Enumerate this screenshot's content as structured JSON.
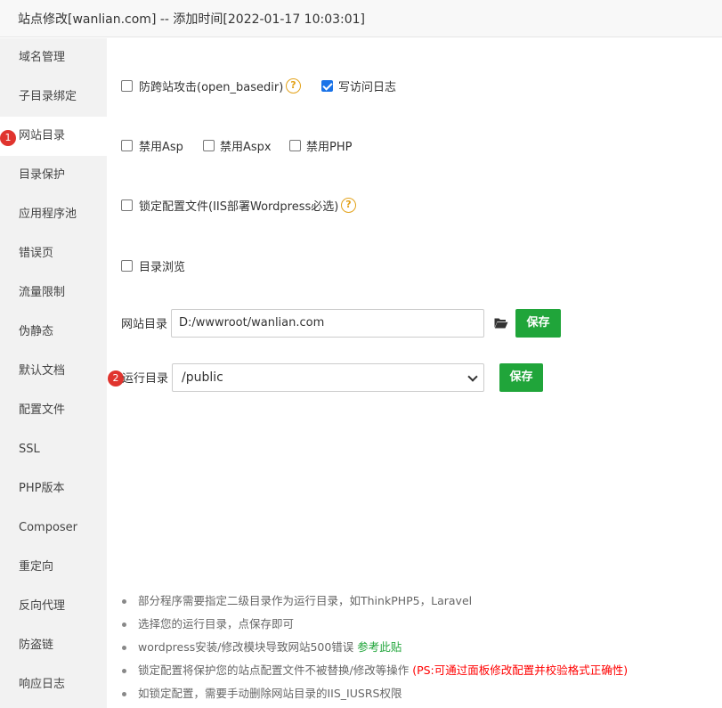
{
  "window": {
    "title": "站点修改[wanlian.com] -- 添加时间[2022-01-17 10:03:01]"
  },
  "sidebar": {
    "items": [
      {
        "label": "域名管理"
      },
      {
        "label": "子目录绑定"
      },
      {
        "label": "网站目录",
        "active": true,
        "badge": "1"
      },
      {
        "label": "目录保护"
      },
      {
        "label": "应用程序池"
      },
      {
        "label": "错误页"
      },
      {
        "label": "流量限制"
      },
      {
        "label": "伪静态"
      },
      {
        "label": "默认文档"
      },
      {
        "label": "配置文件"
      },
      {
        "label": "SSL"
      },
      {
        "label": "PHP版本"
      },
      {
        "label": "Composer"
      },
      {
        "label": "重定向"
      },
      {
        "label": "反向代理"
      },
      {
        "label": "防盗链"
      },
      {
        "label": "响应日志"
      }
    ]
  },
  "options": {
    "open_basedir": {
      "label": "防跨站攻击(open_basedir)",
      "checked": false
    },
    "access_log": {
      "label": "写访问日志",
      "checked": true
    },
    "disable_asp": {
      "label": "禁用Asp",
      "checked": false
    },
    "disable_aspx": {
      "label": "禁用Aspx",
      "checked": false
    },
    "disable_php": {
      "label": "禁用PHP",
      "checked": false
    },
    "lock_config": {
      "label": "锁定配置文件(IIS部署Wordpress必选)",
      "checked": false
    },
    "dir_browse": {
      "label": "目录浏览",
      "checked": false
    }
  },
  "site_dir": {
    "label": "网站目录",
    "value": "D:/wwwroot/wanlian.com",
    "save_label": "保存"
  },
  "run_dir": {
    "label": "运行目录",
    "badge": "2",
    "value": "/public",
    "save_label": "保存"
  },
  "notes": [
    {
      "text": "部分程序需要指定二级目录作为运行目录，如ThinkPHP5，Laravel"
    },
    {
      "text": "选择您的运行目录，点保存即可"
    },
    {
      "text": "wordpress安装/修改模块导致网站500错误 ",
      "link": "参考此贴"
    },
    {
      "text": "锁定配置将保护您的站点配置文件不被替换/修改等操作 ",
      "warning": "(PS:可通过面板修改配置并校验格式正确性)"
    },
    {
      "text": "如锁定配置，需要手动删除网站目录的IIS_IUSRS权限"
    }
  ],
  "colors": {
    "accent_green": "#20a53a",
    "checkbox_blue": "#1a73e8",
    "badge_red": "#e0342e",
    "help_orange": "#e3a21a"
  }
}
